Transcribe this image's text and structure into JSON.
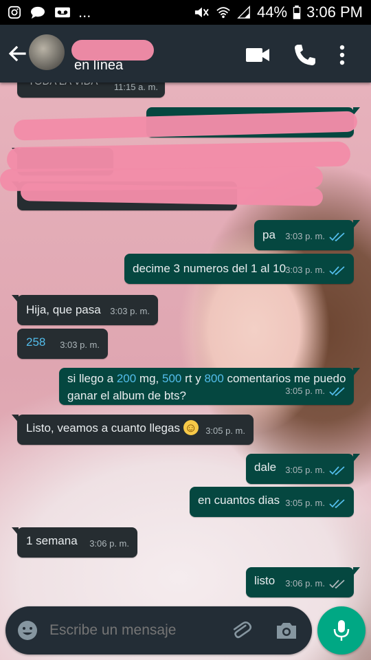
{
  "status_bar": {
    "battery": "44%",
    "time": "3:06 PM",
    "overflow": "..."
  },
  "header": {
    "contact_status": "en línea"
  },
  "messages_partial": [
    {
      "text": "TODA LA VIDA",
      "time": "11:15 a. m."
    }
  ],
  "messages": [
    {
      "dir": "out",
      "text": "pa",
      "time": "3:03 p. m."
    },
    {
      "dir": "out",
      "text": "decime 3 numeros del 1 al 10",
      "time": "3:03 p. m."
    },
    {
      "dir": "in",
      "text": "Hija, que pasa",
      "time": "3:03 p. m."
    },
    {
      "dir": "in",
      "text": "258",
      "time": "3:03 p. m."
    },
    {
      "dir": "out",
      "text_parts": [
        "si llego a ",
        "200",
        " mg, ",
        "500",
        " rt y ",
        "800",
        " comentarios me puedo",
        "ganar el album de bts?"
      ],
      "time": "3:05 p. m."
    },
    {
      "dir": "in",
      "text": "Listo, veamos a cuanto llegas",
      "emoji": "☺",
      "time": "3:05 p. m."
    },
    {
      "dir": "out",
      "text": "dale",
      "time": "3:05 p. m."
    },
    {
      "dir": "out",
      "text": "en cuantos dias",
      "time": "3:05 p. m."
    },
    {
      "dir": "in",
      "text": "1 semana",
      "time": "3:06 p. m."
    },
    {
      "dir": "out",
      "text": "listo",
      "time": "3:06 p. m."
    }
  ],
  "composer": {
    "placeholder": "Escribe un mensaje"
  },
  "colors": {
    "appbar": "#232d36",
    "incoming": "#262d31",
    "outgoing": "#054740",
    "accent": "#00a884",
    "read_ticks": "#53bdeb",
    "redaction": "#f28ca8"
  },
  "icons": [
    "instagram-icon",
    "chat-icon",
    "voicemail-icon",
    "mute-icon",
    "wifi-icon",
    "signal-icon",
    "battery-icon",
    "back-arrow-icon",
    "video-call-icon",
    "phone-icon",
    "more-vert-icon",
    "emoji-icon",
    "attach-icon",
    "camera-icon",
    "mic-icon",
    "double-check-icon"
  ]
}
